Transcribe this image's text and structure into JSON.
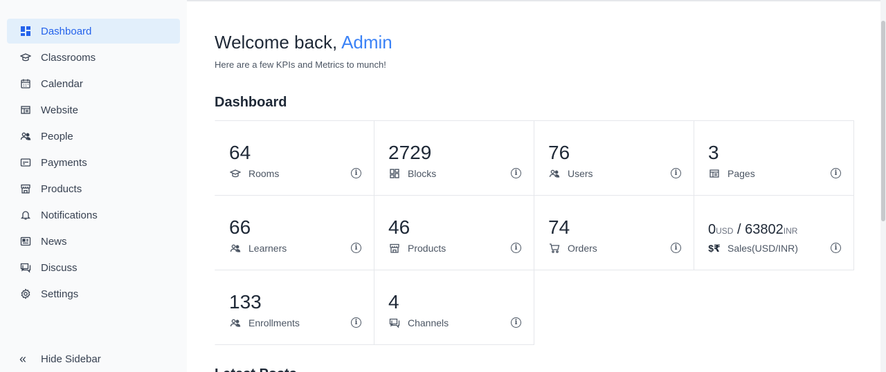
{
  "sidebar": {
    "items": [
      {
        "label": "Dashboard",
        "icon": "dashboard-icon",
        "active": true
      },
      {
        "label": "Classrooms",
        "icon": "graduation-cap-icon"
      },
      {
        "label": "Calendar",
        "icon": "calendar-icon"
      },
      {
        "label": "Website",
        "icon": "website-layout-icon"
      },
      {
        "label": "People",
        "icon": "people-icon"
      },
      {
        "label": "Payments",
        "icon": "credit-card-icon"
      },
      {
        "label": "Products",
        "icon": "store-icon"
      },
      {
        "label": "Notifications",
        "icon": "bell-icon"
      },
      {
        "label": "News",
        "icon": "newspaper-icon"
      },
      {
        "label": "Discuss",
        "icon": "chat-icon"
      },
      {
        "label": "Settings",
        "icon": "gear-icon"
      }
    ],
    "hide_label": "Hide Sidebar"
  },
  "main": {
    "welcome_prefix": "Welcome back,",
    "welcome_name": "Admin",
    "subtitle": "Here are a few KPIs and Metrics to munch!",
    "section_title": "Dashboard",
    "cards": [
      {
        "value": "64",
        "label": "Rooms",
        "icon": "graduation-cap-icon"
      },
      {
        "value": "2729",
        "label": "Blocks",
        "icon": "blocks-icon"
      },
      {
        "value": "76",
        "label": "Users",
        "icon": "people-icon"
      },
      {
        "value": "3",
        "label": "Pages",
        "icon": "website-layout-icon"
      },
      {
        "value": "66",
        "label": "Learners",
        "icon": "people-icon"
      },
      {
        "value": "46",
        "label": "Products",
        "icon": "store-icon"
      },
      {
        "value": "74",
        "label": "Orders",
        "icon": "cart-icon"
      },
      {
        "value_usd": "0",
        "unit_usd": "USD",
        "separator": "/",
        "value_inr": "63802",
        "unit_inr": "INR",
        "label": "Sales(USD/INR)",
        "icon": "currency-icon"
      },
      {
        "value": "133",
        "label": "Enrollments",
        "icon": "people-icon"
      },
      {
        "value": "4",
        "label": "Channels",
        "icon": "chat-icon"
      }
    ],
    "info_glyph": "i",
    "next_section_partial": "Latest Posts"
  },
  "colors": {
    "accent": "#3b82f6",
    "active_bg": "#e2effb",
    "sidebar_bg": "#f9fafb"
  }
}
